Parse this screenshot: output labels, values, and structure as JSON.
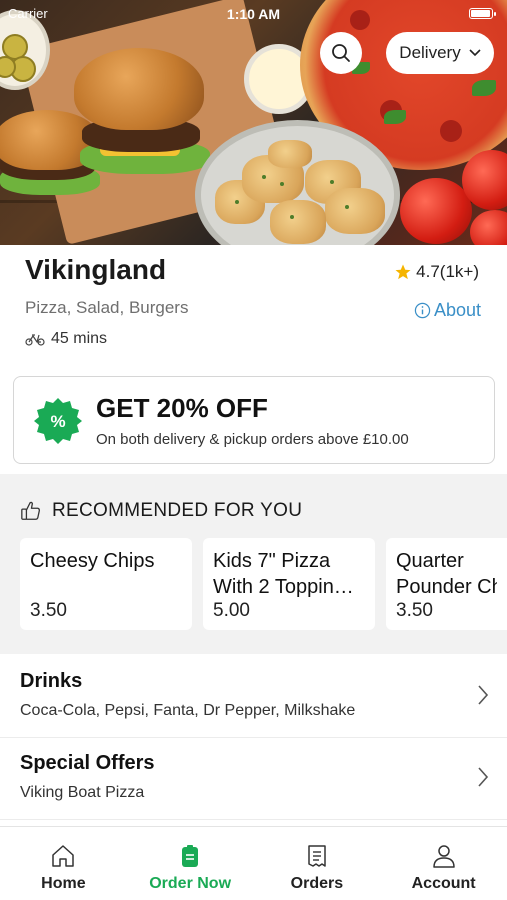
{
  "status_bar": {
    "carrier": "Carrier",
    "time": "1:10 AM",
    "battery_level": 1.0
  },
  "header": {
    "delivery_label": "Delivery",
    "search_icon": "search-icon",
    "dropdown_icon": "chevron-down-icon"
  },
  "restaurant": {
    "name": "Vikingland",
    "rating": "4.7(1k+)",
    "cuisine": "Pizza, Salad, Burgers",
    "about_label": "About",
    "delivery_time": "45 mins"
  },
  "offer": {
    "badge_symbol": "%",
    "title": "GET 20% OFF",
    "subtitle": "On both delivery & pickup orders above £10.00"
  },
  "recommended": {
    "title": "RECOMMENDED FOR YOU",
    "items": [
      {
        "name": [
          "Cheesy Chips"
        ],
        "price": "3.50"
      },
      {
        "name": [
          "Kids 7\" Pizza",
          "With 2 Toppin…"
        ],
        "price": "5.00"
      },
      {
        "name": [
          "Quarter",
          "Pounder Ch"
        ],
        "price": "3.50"
      }
    ]
  },
  "categories": [
    {
      "title": "Drinks",
      "subtitle": "Coca-Cola, Pepsi, Fanta, Dr Pepper, Milkshake"
    },
    {
      "title": "Special Offers",
      "subtitle": "Viking Boat Pizza"
    }
  ],
  "bottom_nav": [
    {
      "label": "Home",
      "icon": "home-icon",
      "active": false
    },
    {
      "label": "Order Now",
      "icon": "order-icon",
      "active": true
    },
    {
      "label": "Orders",
      "icon": "receipt-icon",
      "active": false
    },
    {
      "label": "Account",
      "icon": "account-icon",
      "active": false
    }
  ],
  "colors": {
    "accent_green": "#1aaa55",
    "link_blue": "#3a8fc7",
    "star": "#f5b400"
  }
}
